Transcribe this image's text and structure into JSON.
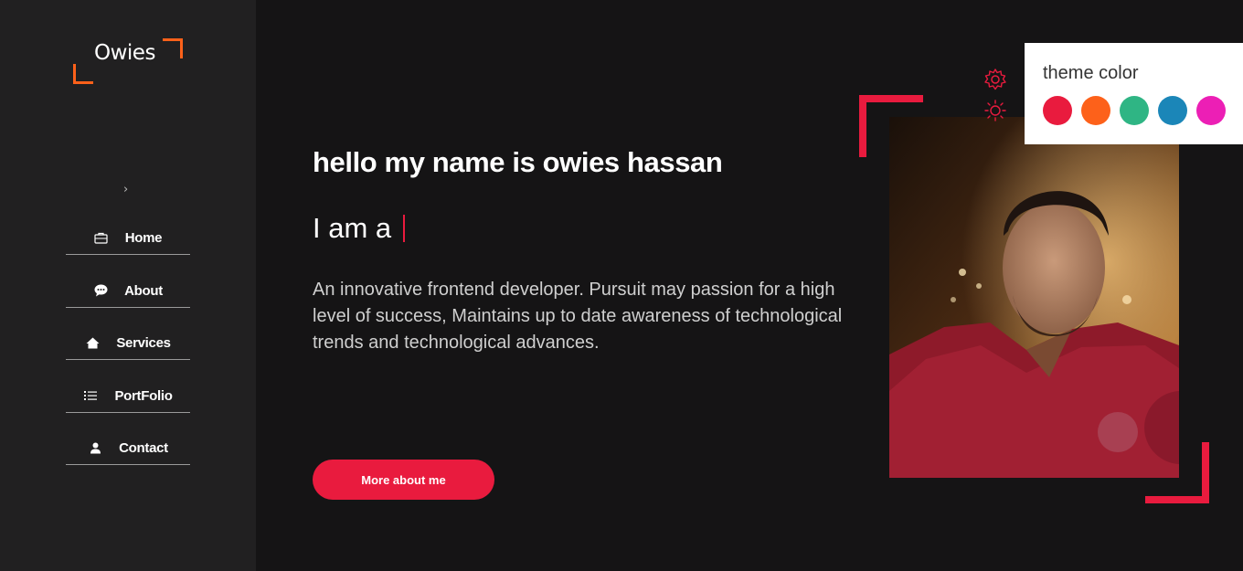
{
  "logo": {
    "text": "Owies"
  },
  "sidebar": {
    "toggle_glyph": "›",
    "items": [
      {
        "label": "Home",
        "icon": "briefcase-icon"
      },
      {
        "label": "About",
        "icon": "chat-bubble-icon"
      },
      {
        "label": "Services",
        "icon": "house-icon"
      },
      {
        "label": "PortFolio",
        "icon": "list-icon"
      },
      {
        "label": "Contact",
        "icon": "user-icon"
      }
    ]
  },
  "hero": {
    "greeting": "hello my name is owies hassan",
    "iam_prefix": "I am a",
    "description": "An innovative frontend developer. Pursuit may passion for a high level of success, Maintains up to date awareness of technological trends and technological advances.",
    "button_label": "More about me"
  },
  "theme_panel": {
    "title": "theme color",
    "swatches": [
      "#e91b3e",
      "#fd611a",
      "#2fb584",
      "#1b86b8",
      "#ec1fb5"
    ]
  },
  "colors": {
    "accent": "#e91b3e",
    "logo_accent": "#fd611a",
    "background": "#151415",
    "sidebar": "#212021"
  }
}
